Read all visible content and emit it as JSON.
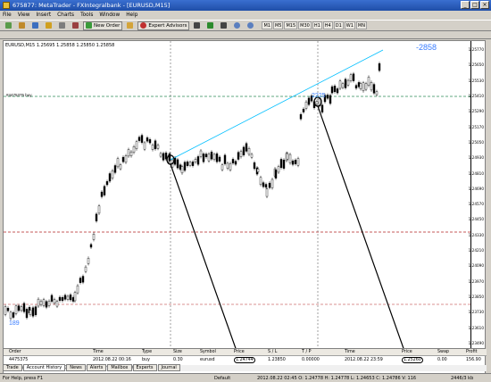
{
  "window": {
    "title": "675877: MetaTrader - FXIntegralbank - [EURUSD,M15]"
  },
  "menu": [
    "File",
    "View",
    "Insert",
    "Charts",
    "Tools",
    "Window",
    "Help"
  ],
  "toolbar": {
    "new_order": "New Order",
    "expert_advisors": "Expert Advisors",
    "timeframes": [
      "M1",
      "M5",
      "M15",
      "M30",
      "H1",
      "H4",
      "D1",
      "W1",
      "MN"
    ]
  },
  "chart": {
    "info": "EURUSD,M15  1.25695 1.25858 1.25850 1.25858",
    "level_label": "#4475375 buy",
    "annotation_left": "189",
    "annotation_right": "-2858",
    "annotation_mid": "2225",
    "yticks": [
      "1.25770",
      "1.25650",
      "1.25530",
      "1.25410",
      "1.25290",
      "1.25170",
      "1.25050",
      "1.24930",
      "1.24810",
      "1.24690",
      "1.24570",
      "1.24450",
      "1.24330",
      "1.24210",
      "1.24090",
      "1.23970",
      "1.23850",
      "1.23730",
      "1.23610",
      "1.23490"
    ],
    "xticks": [
      "20 Aug 2012",
      "21 Aug 04:00",
      "21 Aug 12:00",
      "21 Aug 20:00",
      "22 Aug 04:00",
      "22 Aug 12:00",
      "22 Aug 20:00",
      "23 Aug 04:00",
      "23 Aug 12:00",
      "23 Aug 20:00",
      "24 Aug 04:00"
    ],
    "colors": {
      "candle": "#000000",
      "trend": "#00bfff",
      "dashed_v": "#404040",
      "level_green": "#2e8b57",
      "level_red": "#b22222",
      "annotation": "#3a7dff",
      "pointer": "#000000"
    }
  },
  "chart_tabs": [
    "EURUSD,M15",
    "GBPUSD,H1",
    "EURUSD,H1"
  ],
  "terminal": {
    "headers": [
      "Order",
      "Time",
      "Type",
      "Size",
      "Symbol",
      "Price",
      "S / L",
      "T / P",
      "Time",
      "Price",
      "Swap",
      "Profit"
    ],
    "row": [
      "4475375",
      "2012.08.22 00:16",
      "buy",
      "0.30",
      "eurusd",
      "1.24744",
      "1.23850",
      "0.00000",
      "2012.08.22 23:59",
      "1.25260",
      "0.00",
      "156.90"
    ],
    "balance": "Profit/Loss: 156.90  Credit: 0.00  Deposit: 0.00  Withdrawal: 0.00"
  },
  "terminal_tabs": [
    "Trade",
    "Account History",
    "News",
    "Alerts",
    "Mailbox",
    "Experts",
    "Journal"
  ],
  "status": {
    "help": "For Help, press F1",
    "profile": "Default",
    "ohlc": "2012.08.22 02:45  O: 1.24778  H: 1.24778  L: 1.24653  C: 1.24786  V: 116",
    "traffic": "2446/3 kb"
  }
}
